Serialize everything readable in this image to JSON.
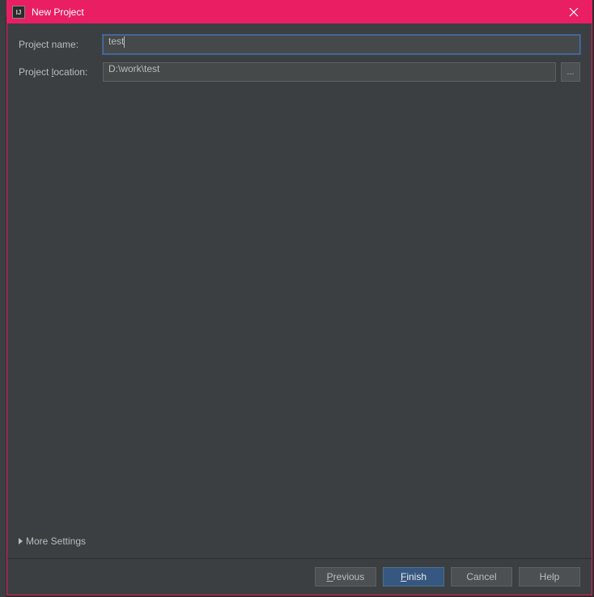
{
  "titlebar": {
    "app_icon_text": "IJ",
    "title": "New Project"
  },
  "form": {
    "project_name_label": "Project name:",
    "project_name_value": "test",
    "project_location_label_pre": "Project ",
    "project_location_label_mn": "l",
    "project_location_label_post": "ocation:",
    "project_location_value": "D:\\work\\test",
    "browse_label": "..."
  },
  "more_settings": {
    "label": "More Settings"
  },
  "footer": {
    "previous_mn": "P",
    "previous_post": "revious",
    "finish_mn": "F",
    "finish_post": "inish",
    "cancel": "Cancel",
    "help": "Help"
  }
}
